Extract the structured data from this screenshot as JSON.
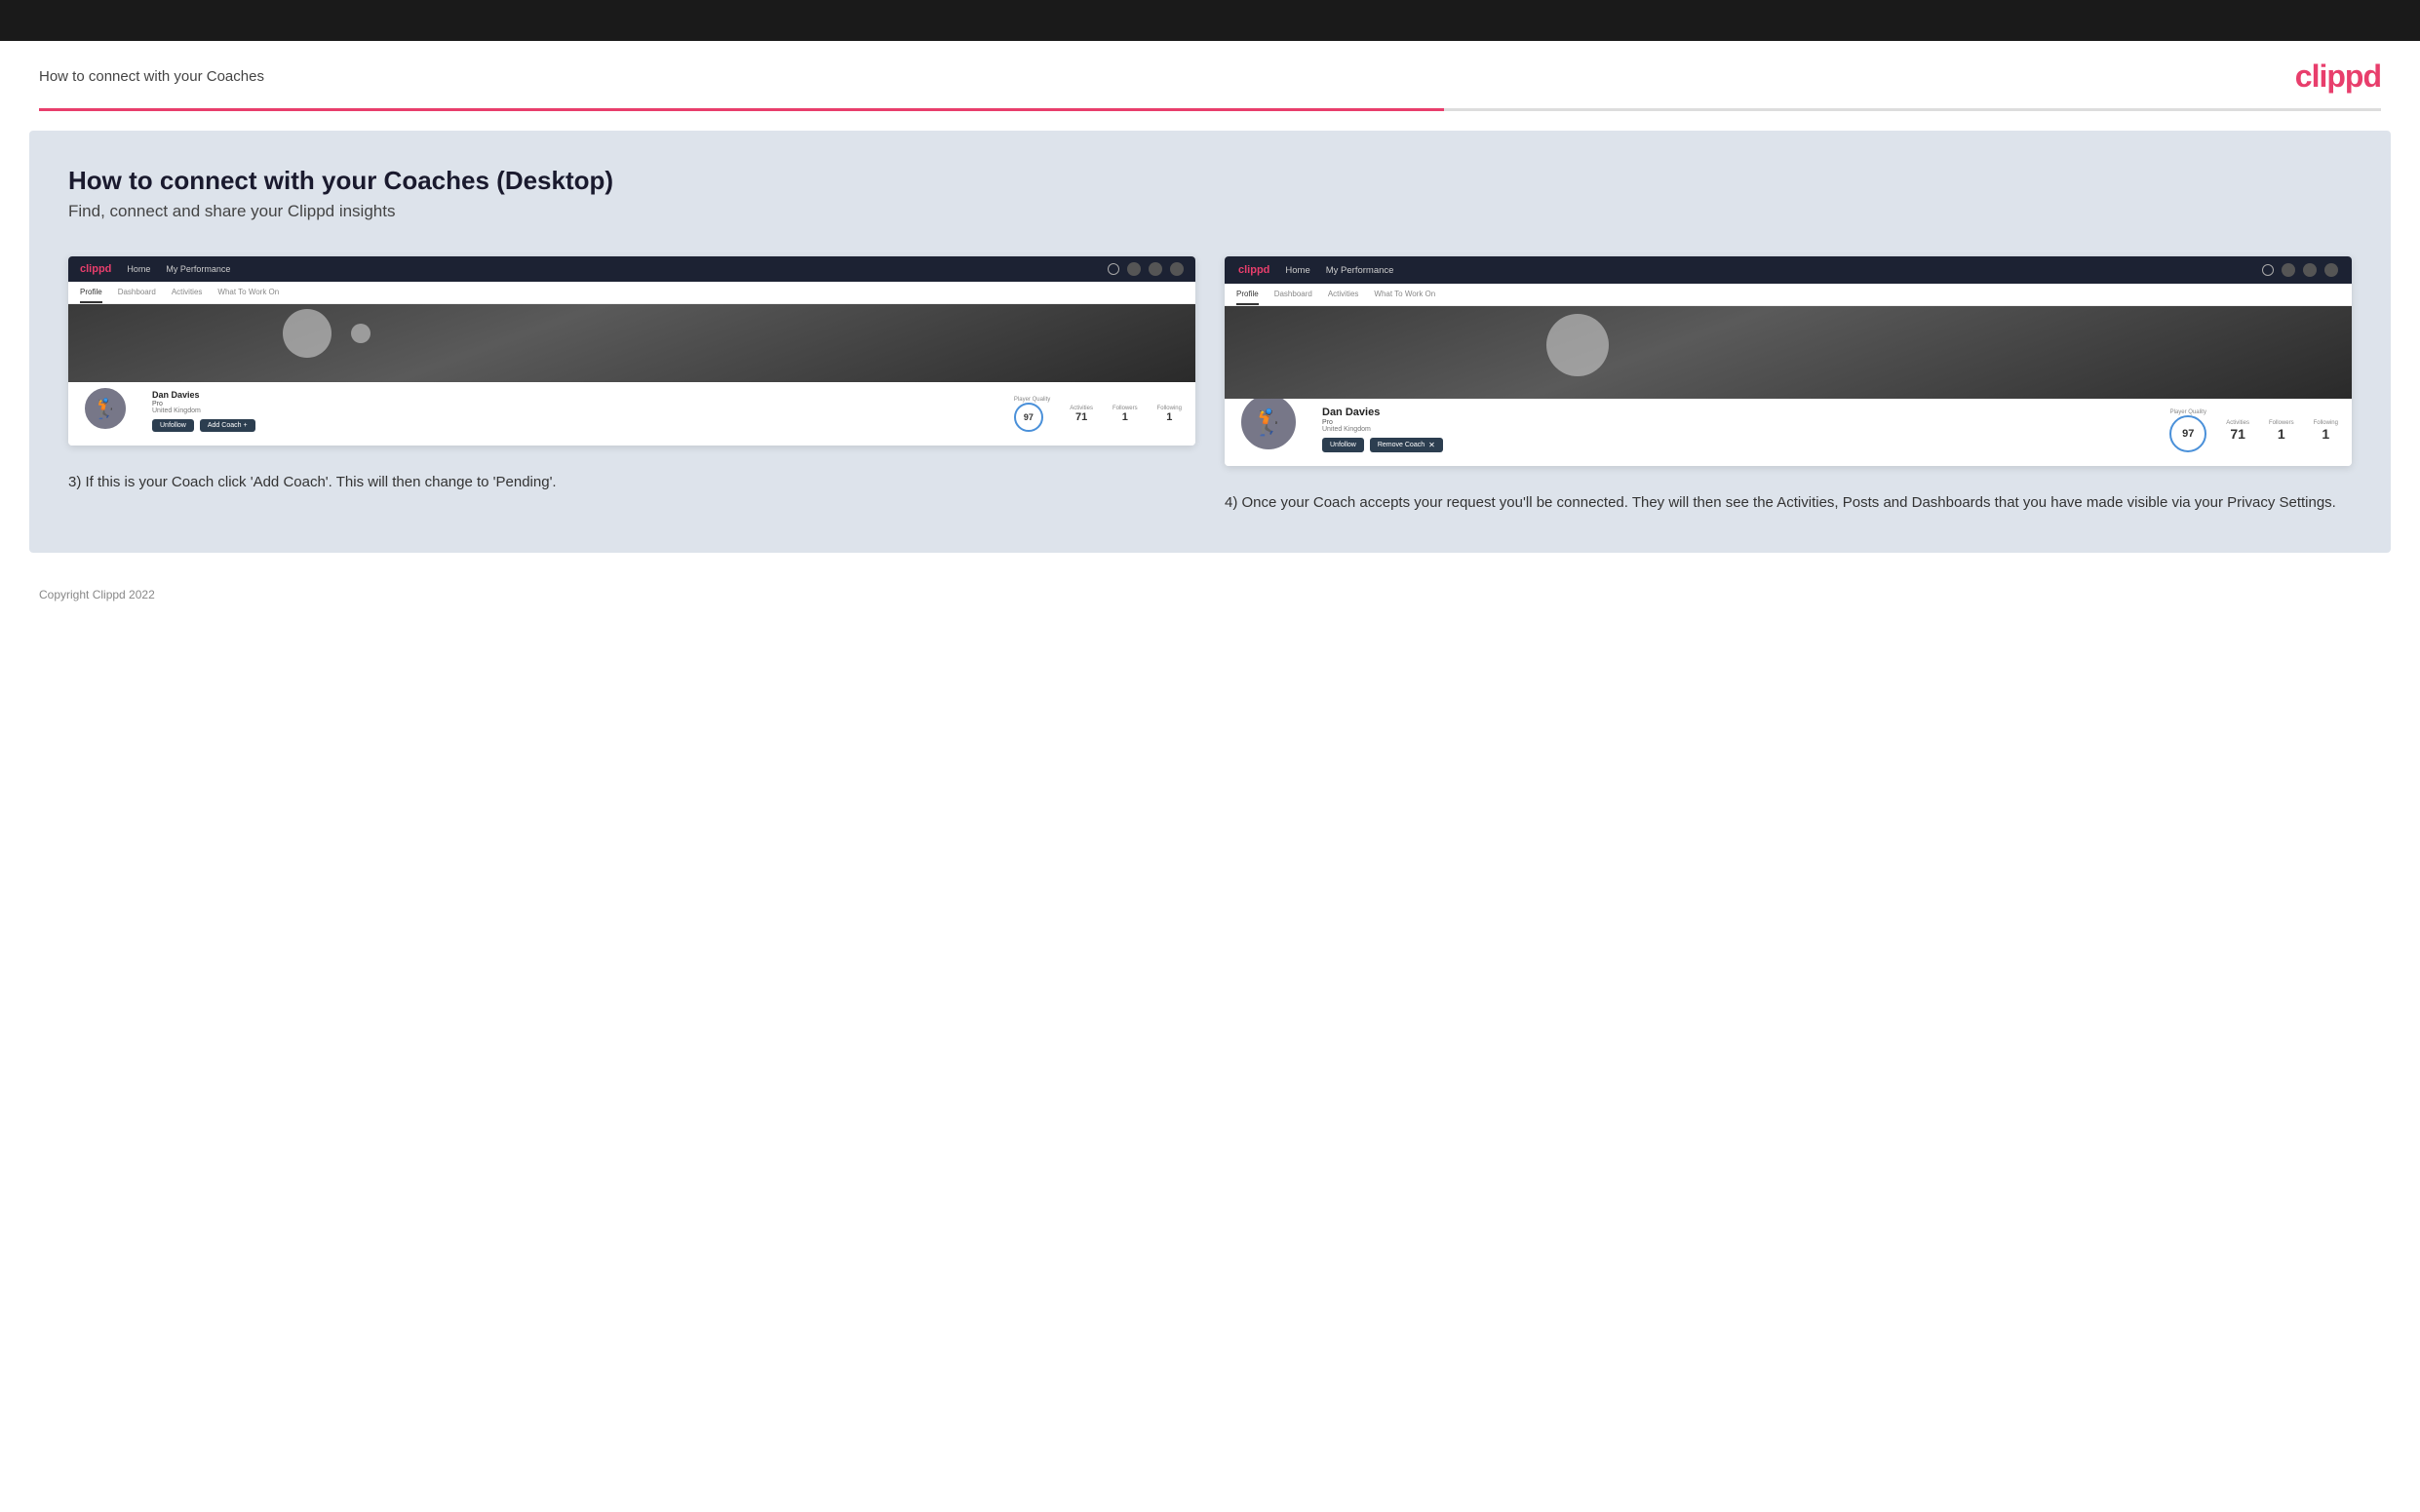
{
  "page": {
    "title": "How to connect with your Coaches",
    "logo": "clippd",
    "copyright": "Copyright Clippd 2022"
  },
  "main": {
    "heading": "How to connect with your Coaches (Desktop)",
    "subheading": "Find, connect and share your Clippd insights"
  },
  "left_panel": {
    "nav": {
      "logo": "clippd",
      "home": "Home",
      "my_performance": "My Performance"
    },
    "tabs": {
      "profile": "Profile",
      "dashboard": "Dashboard",
      "activities": "Activities",
      "what_to_work_on": "What To Work On"
    },
    "profile": {
      "name": "Dan Davies",
      "badge": "Pro",
      "location": "United Kingdom",
      "player_quality_label": "Player Quality",
      "player_quality_value": "97",
      "activities_label": "Activities",
      "activities_value": "71",
      "followers_label": "Followers",
      "followers_value": "1",
      "following_label": "Following",
      "following_value": "1"
    },
    "buttons": {
      "unfollow": "Unfollow",
      "add_coach": "Add Coach"
    },
    "description": "3) If this is your Coach click 'Add Coach'. This will then change to 'Pending'."
  },
  "right_panel": {
    "nav": {
      "logo": "clippd",
      "home": "Home",
      "my_performance": "My Performance"
    },
    "tabs": {
      "profile": "Profile",
      "dashboard": "Dashboard",
      "activities": "Activities",
      "what_to_work_on": "What To Work On"
    },
    "profile": {
      "name": "Dan Davies",
      "badge": "Pro",
      "location": "United Kingdom",
      "player_quality_label": "Player Quality",
      "player_quality_value": "97",
      "activities_label": "Activities",
      "activities_value": "71",
      "followers_label": "Followers",
      "followers_value": "1",
      "following_label": "Following",
      "following_value": "1"
    },
    "buttons": {
      "unfollow": "Unfollow",
      "remove_coach": "Remove Coach"
    },
    "description": "4) Once your Coach accepts your request you'll be connected. They will then see the Activities, Posts and Dashboards that you have made visible via your Privacy Settings."
  }
}
